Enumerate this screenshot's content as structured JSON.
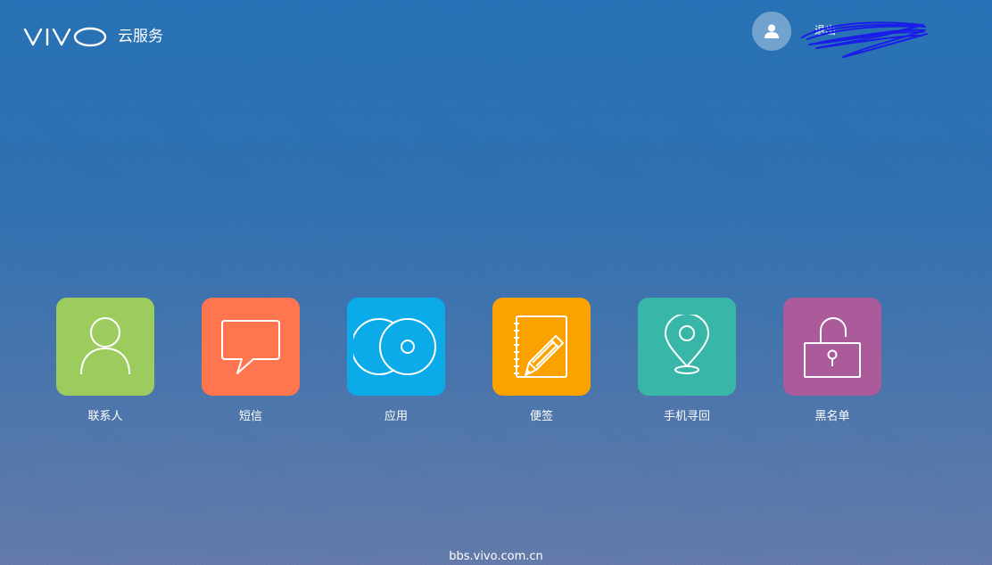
{
  "header": {
    "brand_name": "vivo",
    "brand_subtitle": "云服务",
    "user_name": "退出"
  },
  "apps": [
    {
      "label": "联系人",
      "icon": "contacts-icon",
      "color": "#9ccc5e"
    },
    {
      "label": "短信",
      "icon": "message-icon",
      "color": "#ff7550"
    },
    {
      "label": "应用",
      "icon": "apps-disc-icon",
      "color": "#0aabe8"
    },
    {
      "label": "便签",
      "icon": "notepad-icon",
      "color": "#fca200"
    },
    {
      "label": "手机寻回",
      "icon": "location-pin-icon",
      "color": "#38b7a8"
    },
    {
      "label": "黑名单",
      "icon": "unlock-icon",
      "color": "#ab5a9a"
    }
  ],
  "footer": {
    "watermark": "bbs.vivo.com.cn"
  }
}
